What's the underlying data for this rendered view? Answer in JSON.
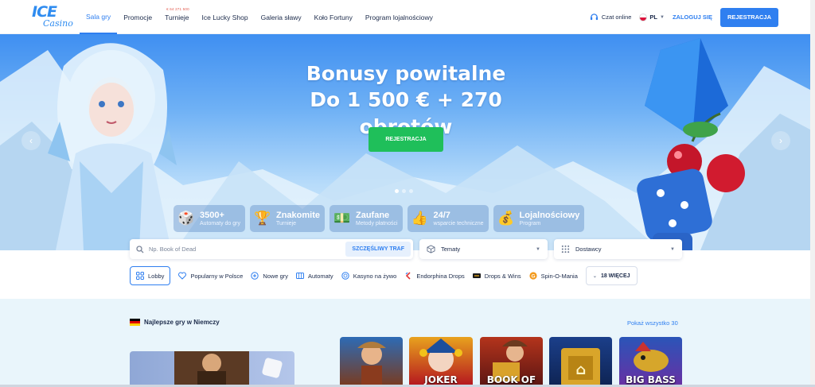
{
  "header": {
    "logo_top": "ICE",
    "logo_bottom": "Casino",
    "nav": [
      {
        "label": "Sala gry",
        "active": true
      },
      {
        "label": "Promocje"
      },
      {
        "label": "Turnieje",
        "badge": "€ 64 271 500"
      },
      {
        "label": "Ice Lucky Shop"
      },
      {
        "label": "Galeria sławy"
      },
      {
        "label": "Koło Fortuny"
      },
      {
        "label": "Program lojalnościowy"
      }
    ],
    "chat_label": "Czat online",
    "lang": "PL",
    "login_label": "ZALOGUJ SIĘ",
    "register_label": "REJESTRACJA"
  },
  "hero": {
    "title_line1": "Bonusy powitalne",
    "title_line2": "Do 1 500 € + 270 obrotów",
    "cta_label": "REJESTRACJA",
    "slides": 3,
    "active_slide": 1,
    "features": [
      {
        "icon": "dice-icon",
        "title": "3500+",
        "subtitle": "Automaty do gry"
      },
      {
        "icon": "trophy-icon",
        "title": "Znakomite",
        "subtitle": "Turnieje"
      },
      {
        "icon": "money-icon",
        "title": "Zaufane",
        "subtitle": "Metody płatności"
      },
      {
        "icon": "thumbs-up-icon",
        "title": "24/7",
        "subtitle": "wsparcie techniczne"
      },
      {
        "icon": "money-bag-icon",
        "title": "Lojalnościowy",
        "subtitle": "Program"
      }
    ]
  },
  "search": {
    "placeholder": "Np. Book of Dead",
    "lucky_label": "SZCZĘŚLIWY TRAF",
    "themes_label": "Tematy",
    "providers_label": "Dostawcy"
  },
  "categories": [
    {
      "label": "Lobby",
      "icon": "grid-icon",
      "active": true
    },
    {
      "label": "Popularny w Polsce",
      "icon": "heart-icon"
    },
    {
      "label": "Nowe gry",
      "icon": "plus-circle-icon"
    },
    {
      "label": "Automaty",
      "icon": "slot-icon"
    },
    {
      "label": "Kasyno na żywo",
      "icon": "chip-icon"
    },
    {
      "label": "Endorphina Drops",
      "icon": "endorphina-icon"
    },
    {
      "label": "Drops & Wins",
      "icon": "drops-icon"
    },
    {
      "label": "Spin-O-Mania",
      "icon": "spin-icon"
    }
  ],
  "more_label": "18 WIĘCEJ",
  "games_section": {
    "title": "Najlepsze gry w Niemczy",
    "show_all": "Pokaż wszystko 30",
    "tiles": [
      {
        "caption": "",
        "color": "#3a6aa8"
      },
      {
        "caption": "JOKER",
        "color": "#1d4f9c"
      },
      {
        "caption": "BOOK OF",
        "color": "#7a1f1a"
      },
      {
        "caption": "",
        "color": "#1b3f8a"
      },
      {
        "caption": "BIG BASS",
        "color": "#2a55b8"
      }
    ]
  },
  "colors": {
    "accent": "#2f7ff0",
    "cta": "#1fbf5a"
  }
}
